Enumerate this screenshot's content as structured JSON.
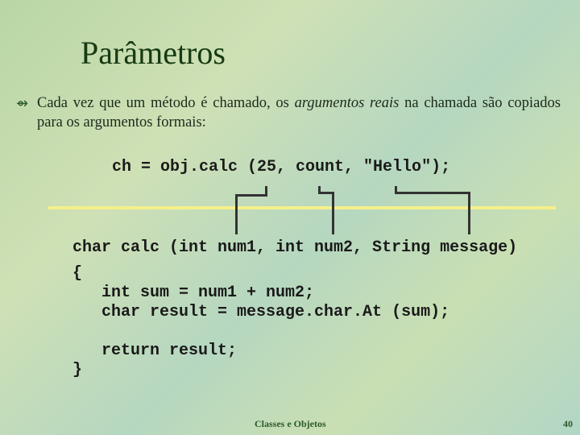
{
  "title": "Parâmetros",
  "bullet": {
    "icon": "hand-pointer-icon",
    "before": "Cada vez que um método é chamado, os ",
    "italic": "argumentos reais",
    "after": " na chamada são copiados para os argumentos formais:"
  },
  "call_line": "ch = obj.calc (25, count, \"Hello\");",
  "code": [
    "char calc (int num1, int num2, String message)",
    "{",
    "   int sum = num1 + num2;",
    "   char result = message.char.At (sum);",
    "   return result;",
    "}"
  ],
  "footer": {
    "center": "Classes e Objetos",
    "page": "40"
  },
  "colors": {
    "title": "#163a12",
    "divider": "#f5f08a"
  }
}
